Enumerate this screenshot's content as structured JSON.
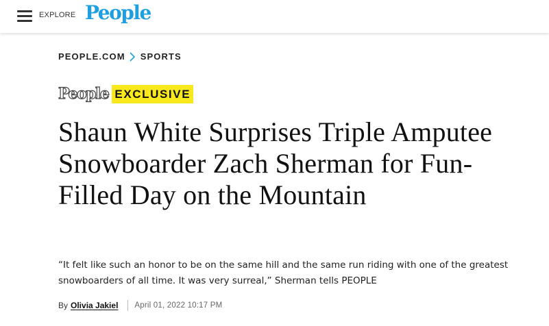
{
  "header": {
    "menu_icon": "hamburger-menu-icon",
    "explore_label": "EXPLORE",
    "logo_text": "People",
    "logo_color": "#1f9fe0"
  },
  "breadcrumb": {
    "items": [
      "PEOPLE.COM",
      "SPORTS"
    ],
    "separator_icon": "chevron-right-icon",
    "separator_color": "#1f9fe0"
  },
  "badge": {
    "logo_text": "People",
    "label": "EXCLUSIVE",
    "highlight_color": "#f8e81c"
  },
  "article": {
    "headline": "Shaun White Surprises Triple Amputee Snowboarder Zach Sherman for Fun-Filled Day on the Mountain",
    "dek": "“It felt like such an honor to be on the same hill and the same run riding with one of the greatest snowboarders of all time. It was very surreal,” Sherman tells PEOPLE",
    "byline_prefix": "By",
    "author": "Olivia Jakiel",
    "date": "April 01, 2022 10:17 PM"
  }
}
